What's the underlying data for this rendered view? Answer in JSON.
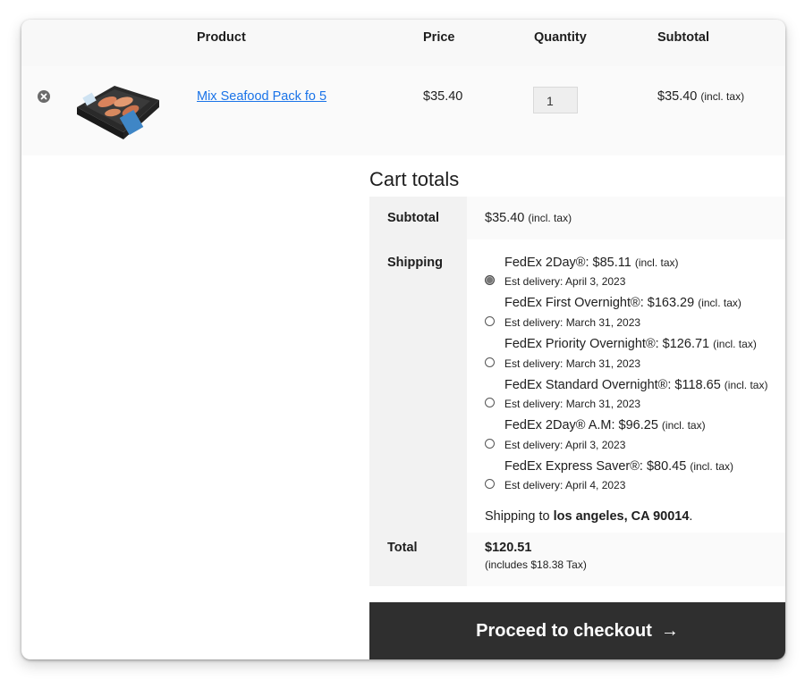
{
  "cart_table": {
    "headers": {
      "product": "Product",
      "price": "Price",
      "quantity": "Quantity",
      "subtotal": "Subtotal"
    },
    "item": {
      "name": "Mix Seafood Pack fo 5",
      "price": "$35.40",
      "quantity": "1",
      "subtotal": "$35.40",
      "subtotal_note": "(incl. tax)"
    }
  },
  "cart_totals": {
    "title": "Cart totals",
    "subtotal_label": "Subtotal",
    "subtotal_value": "$35.40",
    "subtotal_note": "(incl. tax)",
    "shipping_label": "Shipping",
    "shipping_options": [
      {
        "name": "FedEx 2Day®: $85.11",
        "note": "(incl. tax)",
        "est": "Est delivery: April 3, 2023",
        "selected": true
      },
      {
        "name": "FedEx First Overnight®: $163.29",
        "note": "(incl. tax)",
        "est": "Est delivery: March 31, 2023",
        "selected": false
      },
      {
        "name": "FedEx Priority Overnight®: $126.71",
        "note": "(incl. tax)",
        "est": "Est delivery: March 31, 2023",
        "selected": false
      },
      {
        "name": "FedEx Standard Overnight®: $118.65",
        "note": "(incl. tax)",
        "est": "Est delivery: March 31, 2023",
        "selected": false
      },
      {
        "name": "FedEx 2Day® A.M: $96.25",
        "note": "(incl. tax)",
        "est": "Est delivery: April 3, 2023",
        "selected": false
      },
      {
        "name": "FedEx Express Saver®: $80.45",
        "note": "(incl. tax)",
        "est": "Est delivery: April 4, 2023",
        "selected": false
      }
    ],
    "shipping_to_prefix": "Shipping to ",
    "shipping_to_location": "los angeles, CA 90014",
    "shipping_to_suffix": ".",
    "total_label": "Total",
    "total_value": "$120.51",
    "total_note": "(includes $18.38 Tax)"
  },
  "checkout_button": {
    "label": "Proceed to checkout",
    "arrow": "→"
  },
  "colors": {
    "link": "#1a73e8",
    "button_bg": "#2f2f2f",
    "header_bg": "#f8f8f8"
  }
}
